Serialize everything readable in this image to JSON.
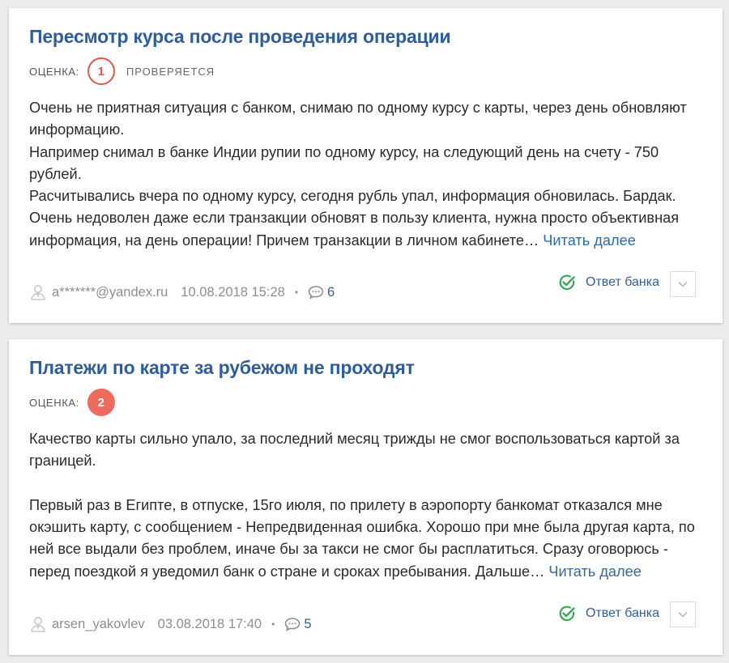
{
  "reviews": [
    {
      "title": "Пересмотр курса после проведения операции",
      "rating_label": "ОЦЕНКА:",
      "rating": "1",
      "status": "ПРОВЕРЯЕТСЯ",
      "paragraphs": [
        "Очень не приятная ситуация с банком, снимаю по одному курсу с карты, через день обновляют информацию.",
        "Например снимал в банке Индии рупии по одному курсу, на следующий день на счету - 750 рублей.",
        "Расчитывались вчера по одному курсу, сегодня рубль упал, информация обновилась. Бардак. Очень недоволен даже если транзакции обновят в пользу клиента, нужна просто объективная информация, на день операции! Причем транзакции в личном кабинете…"
      ],
      "read_more": "Читать далее",
      "author": "a*******@yandex.ru",
      "date": "10.08.2018 15:28",
      "dot": "•",
      "comments": "6",
      "bank_answer": "Ответ банка"
    },
    {
      "title": "Платежи по карте за рубежом не проходят",
      "rating_label": "ОЦЕНКА:",
      "rating": "2",
      "paragraphs": [
        "Качество карты сильно упало, за последний месяц трижды не смог воспользоваться картой за границей.",
        "Первый раз в Египте, в отпуске, 15го июля, по прилету в аэропорту банкомат отказался мне окэшить карту, с сообщением - Непредвиденная ошибка. Хорошо при мне была другая карта, по ней все выдали без проблем, иначе бы за такси не смог бы расплатиться. Сразу оговорюсь - перед поездкой я уведомил банк о стране и сроках пребывания. Дальше…"
      ],
      "read_more": "Читать далее",
      "author": "arsen_yakovlev",
      "date": "03.08.2018 17:40",
      "dot": "•",
      "comments": "5",
      "bank_answer": "Ответ банка"
    }
  ],
  "colors": {
    "title": "#2f5d9b",
    "link": "#2f6aa8",
    "badge_outline": "#e0574a",
    "badge_filled": "#ee6a5d",
    "check": "#3aa655",
    "meta_gray": "#8a8f96"
  }
}
